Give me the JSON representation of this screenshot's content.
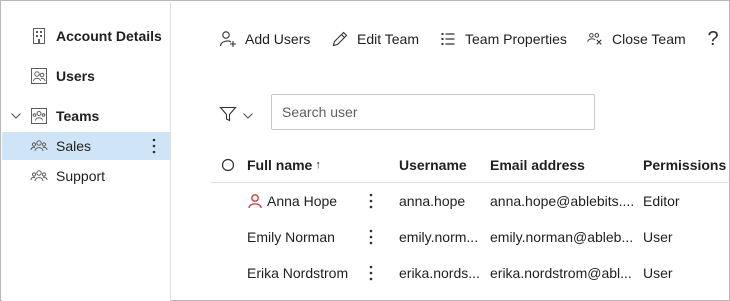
{
  "sidebar": {
    "account_details": "Account Details",
    "users": "Users",
    "teams": "Teams",
    "teams_children": [
      "Sales",
      "Support"
    ]
  },
  "toolbar": {
    "add_users": "Add Users",
    "edit_team": "Edit Team",
    "team_properties": "Team Properties",
    "close_team": "Close Team",
    "help": "?"
  },
  "search": {
    "placeholder": "Search user",
    "value": ""
  },
  "table": {
    "columns": {
      "full_name": "Full name",
      "sort_indicator": "↑",
      "username": "Username",
      "email": "Email address",
      "permissions": "Permissions"
    },
    "rows": [
      {
        "full_name": "Anna Hope",
        "username": "anna.hope",
        "email": "anna.hope@ablebits....",
        "permissions": "Editor",
        "owner": true
      },
      {
        "full_name": "Emily Norman",
        "username": "emily.norm...",
        "email": "emily.norman@ableb...",
        "permissions": "User",
        "owner": false
      },
      {
        "full_name": "Erika Nordstrom",
        "username": "erika.nords...",
        "email": "erika.nordstrom@abl...",
        "permissions": "User",
        "owner": false
      }
    ]
  },
  "colors": {
    "selected_bg": "#cfe4f6",
    "owner_icon": "#d13438",
    "icon": "#323130"
  },
  "icons": {
    "account_details": "building-icon",
    "users": "users-icon",
    "teams": "team-icon",
    "add_users": "add-user-icon",
    "edit_team": "pencil-icon",
    "team_properties": "list-icon",
    "close_team": "close-team-icon",
    "filter": "filter-icon"
  }
}
